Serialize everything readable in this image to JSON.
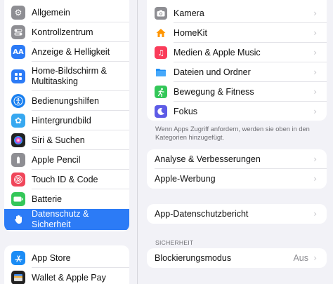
{
  "sidebar": {
    "group1": [
      {
        "label": "Allgemein",
        "icon": "gear-icon",
        "color": "#8e8e93"
      },
      {
        "label": "Kontrollzentrum",
        "icon": "toggles-icon",
        "color": "#8e8e93"
      },
      {
        "label": "Anzeige & Helligkeit",
        "icon": "text-size-icon",
        "color": "#2c7bf6"
      },
      {
        "label": "Home-Bildschirm & Multitasking",
        "label_line1": "Home-Bildschirm &",
        "label_line2": "Multitasking",
        "icon": "home-grid-icon",
        "color": "#2c7bf6"
      },
      {
        "label": "Bedienungshilfen",
        "icon": "accessibility-icon",
        "color": "#1a80f0"
      },
      {
        "label": "Hintergrundbild",
        "icon": "wallpaper-icon",
        "color": "#37a8f0"
      },
      {
        "label": "Siri & Suchen",
        "icon": "siri-icon",
        "color": "#222222"
      },
      {
        "label": "Apple Pencil",
        "icon": "pencil-icon",
        "color": "#8e8e93"
      },
      {
        "label": "Touch ID & Code",
        "icon": "fingerprint-icon",
        "color": "#f0465a"
      },
      {
        "label": "Batterie",
        "icon": "battery-icon",
        "color": "#34c759"
      },
      {
        "label": "Datenschutz & Sicherheit",
        "icon": "hand-icon",
        "color": "#2c7bf6",
        "active": true
      }
    ],
    "group2": [
      {
        "label": "App Store",
        "icon": "app-store-icon",
        "color": "#1b8cf5"
      },
      {
        "label": "Wallet & Apple Pay",
        "icon": "wallet-icon",
        "color": "#222222"
      }
    ]
  },
  "detail": {
    "card1": [
      {
        "label": "Kamera",
        "icon": "camera-icon",
        "color": "#8e8e93"
      },
      {
        "label": "HomeKit",
        "icon": "home-icon",
        "color": "#ff9500"
      },
      {
        "label": "Medien & Apple Music",
        "icon": "music-icon",
        "color": "#fa3c5a"
      },
      {
        "label": "Dateien und Ordner",
        "icon": "folder-icon",
        "color": "#1f8ff5"
      },
      {
        "label": "Bewegung & Fitness",
        "icon": "fitness-icon",
        "color": "#34c759"
      },
      {
        "label": "Fokus",
        "icon": "moon-icon",
        "color": "#5e5ce6"
      }
    ],
    "card1_note": "Wenn Apps Zugriff anfordern, werden sie oben in den Kategorien hinzugefügt.",
    "card2": [
      {
        "label": "Analyse & Verbesserungen"
      },
      {
        "label": "Apple-Werbung"
      }
    ],
    "card3": [
      {
        "label": "App-Datenschutzbericht"
      }
    ],
    "security_header": "SICHERHEIT",
    "card4": [
      {
        "label": "Blockierungsmodus",
        "value": "Aus"
      }
    ]
  }
}
